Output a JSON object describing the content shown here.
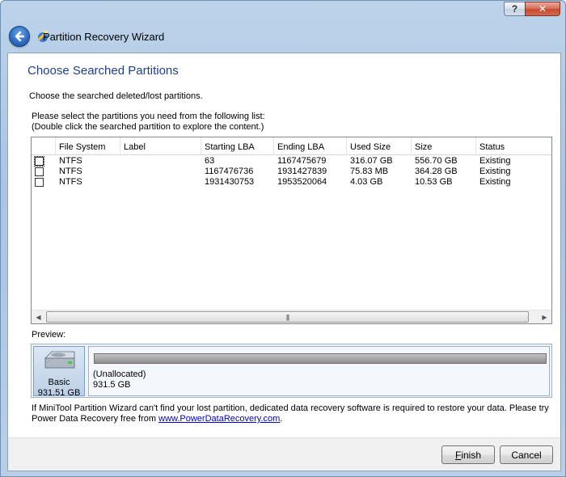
{
  "window": {
    "title": "Partition Recovery Wizard",
    "help_label": "?",
    "close_label": "✕"
  },
  "page": {
    "title": "Choose Searched Partitions",
    "subtitle": "Choose the searched deleted/lost partitions.",
    "instruction1": "Please select the partitions you need from the following list:",
    "instruction2": "(Double click the searched partition to explore the content.)"
  },
  "table": {
    "columns": [
      "",
      "File System",
      "Label",
      "Starting LBA",
      "Ending LBA",
      "Used Size",
      "Size",
      "Status"
    ],
    "rows": [
      {
        "checked": false,
        "file_system": "NTFS",
        "label": "",
        "starting_lba": "63",
        "ending_lba": "1167475679",
        "used_size": "316.07 GB",
        "size": "556.70 GB",
        "status": "Existing"
      },
      {
        "checked": false,
        "file_system": "NTFS",
        "label": "",
        "starting_lba": "1167476736",
        "ending_lba": "1931427839",
        "used_size": "75.83 MB",
        "size": "364.28 GB",
        "status": "Existing"
      },
      {
        "checked": false,
        "file_system": "NTFS",
        "label": "",
        "starting_lba": "1931430753",
        "ending_lba": "1953520064",
        "used_size": "4.03 GB",
        "size": "10.53 GB",
        "status": "Existing"
      }
    ],
    "scroll_thumb_glyph": "|||"
  },
  "preview": {
    "label": "Preview:",
    "disk_type": "Basic",
    "disk_size": "931.51 GB",
    "partition_name": "(Unallocated)",
    "partition_size": "931.5 GB"
  },
  "note": {
    "line1": "If MiniTool Partition Wizard can't find your lost partition, dedicated data recovery software is required to restore your data. Please try",
    "line2_prefix": "Power Data Recovery free from ",
    "link_text": "www.PowerDataRecovery.com",
    "line2_suffix": "."
  },
  "buttons": {
    "finish_mnemonic": "F",
    "finish_rest": "inish",
    "cancel": "Cancel"
  },
  "colors": {
    "title_blue": "#1e3f8c",
    "link_blue": "#0000cc"
  }
}
